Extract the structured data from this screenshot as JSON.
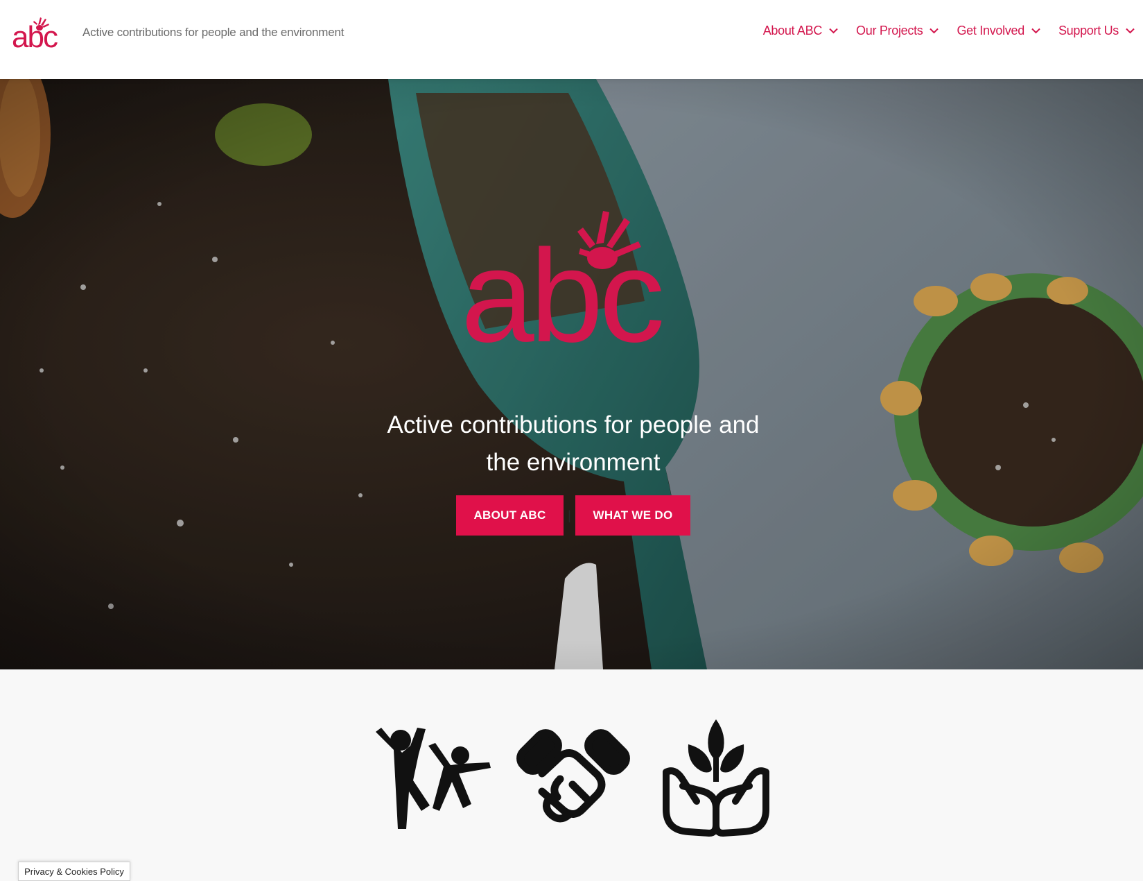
{
  "brand": {
    "name": "abc",
    "tagline": "Active contributions for people and the environment",
    "accent": "#d3164d",
    "button_color": "#e0114a"
  },
  "nav": {
    "items": [
      {
        "label": "About ABC",
        "icon": "chevron-down-icon"
      },
      {
        "label": "Our Projects",
        "icon": "chevron-down-icon"
      },
      {
        "label": "Get Involved",
        "icon": "chevron-down-icon"
      },
      {
        "label": "Support Us",
        "icon": "chevron-down-icon"
      }
    ]
  },
  "hero": {
    "heading_line1": "Active contributions for people and",
    "heading_line2": "the environment",
    "buttons": {
      "about": "About ABC",
      "what": "What we do",
      "separator": "|"
    },
    "background": "soil, trowel and plant pot photo"
  },
  "features": {
    "icons": [
      "people-helping-icon",
      "handshake-icon",
      "hands-plant-icon"
    ]
  },
  "cookie": {
    "label": "Privacy & Cookies Policy"
  }
}
